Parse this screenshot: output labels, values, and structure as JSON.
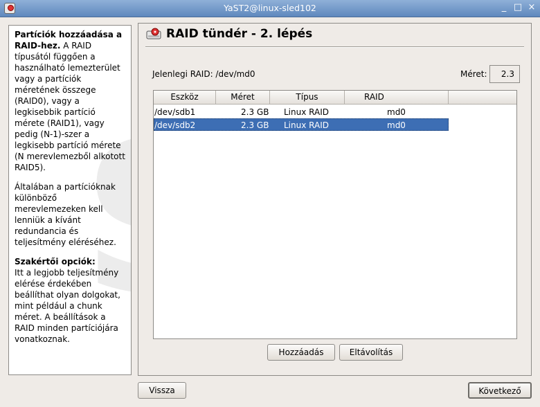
{
  "window": {
    "title": "YaST2@linux-sled102",
    "controls": [
      "_",
      "□",
      "×"
    ]
  },
  "help": {
    "p1_bold": "Partíciók hozzáadása a RAID-hez.",
    "p1_rest": " A RAID típusától függően a használható lemezterület vagy a partíciók méretének összege (RAID0), vagy a legkisebbik partíció mérete (RAID1), vagy pedig (N-1)-szer a legkisebb partíció mérete (N merevlemezből alkotott RAID5).",
    "p2": "Általában a partícióknak különböző merevlemezeken kell lenniük a kívánt redundancia és teljesítmény eléréséhez.",
    "p3_bold": "Szakértői opciók:",
    "p3_rest": "Itt a legjobb teljesítmény elérése érdekében beállíthat olyan dolgokat, mint például a chunk méret. A beállítások a RAID minden partíciójára vonatkoznak."
  },
  "heading": "RAID tündér - 2. lépés",
  "current_raid": "Jelenlegi RAID: /dev/md0",
  "size_label": "Méret:",
  "size_value": "2.3",
  "table": {
    "headers": [
      "Eszköz",
      "Méret",
      "Típus",
      "RAID"
    ],
    "rows": [
      {
        "device": "/dev/sdb1",
        "size": "2.3 GB",
        "type": "Linux RAID",
        "raid": "md0",
        "selected": false
      },
      {
        "device": "/dev/sdb2",
        "size": "2.3 GB",
        "type": "Linux RAID",
        "raid": "md0",
        "selected": true
      }
    ]
  },
  "buttons": {
    "add": "Hozzáadás",
    "remove": "Eltávolítás",
    "back": "Vissza",
    "next": "Következő"
  },
  "colors": {
    "selection": "#3d6eb4",
    "titlebar": "#5f88bd"
  }
}
